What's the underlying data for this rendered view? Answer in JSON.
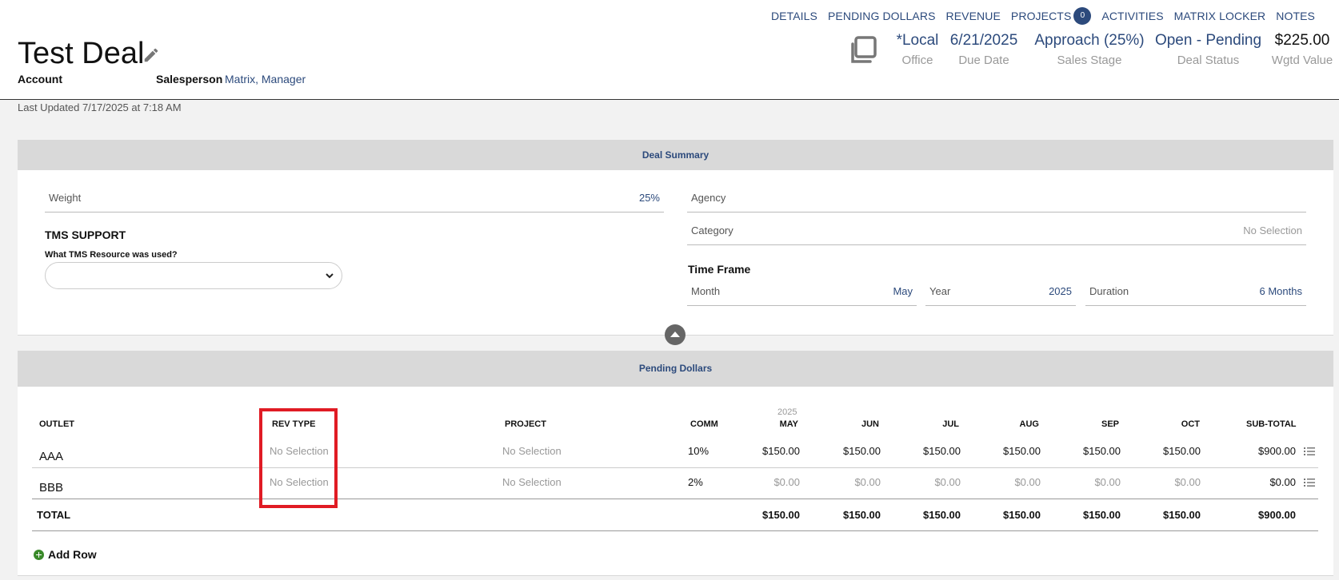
{
  "nav": [
    {
      "label": "DETAILS"
    },
    {
      "label": "PENDING DOLLARS"
    },
    {
      "label": "REVENUE"
    },
    {
      "label": "PROJECTS",
      "badge": "0"
    },
    {
      "label": "ACTIVITIES"
    },
    {
      "label": "MATRIX LOCKER"
    },
    {
      "label": "NOTES"
    }
  ],
  "deal": {
    "title": "Test Deal",
    "account_label": "Account",
    "salesperson_label": "Salesperson",
    "salesperson": "Matrix, Manager",
    "office": "*Local",
    "office_label": "Office",
    "due_date": "6/21/2025",
    "due_date_label": "Due Date",
    "sales_stage": "Approach (25%)",
    "sales_stage_label": "Sales Stage",
    "deal_status": "Open - Pending",
    "deal_status_label": "Deal Status",
    "wgtd_value": "$225.00",
    "wgtd_value_label": "Wgtd Value",
    "last_updated": "Last Updated 7/17/2025 at 7:18 AM"
  },
  "summary": {
    "heading": "Deal Summary",
    "weight_label": "Weight",
    "weight": "25%",
    "tms_heading": "TMS SUPPORT",
    "tms_question": "What TMS Resource was used?",
    "tms_value": "",
    "agency_label": "Agency",
    "agency": "",
    "category_label": "Category",
    "category": "No Selection",
    "timeframe_heading": "Time Frame",
    "month_label": "Month",
    "month": "May",
    "year_label": "Year",
    "year": "2025",
    "duration_label": "Duration",
    "duration": "6 Months"
  },
  "pending": {
    "heading": "Pending Dollars",
    "year_header": "2025",
    "columns": [
      "OUTLET",
      "REV TYPE",
      "PROJECT",
      "COMM",
      "MAY",
      "JUN",
      "JUL",
      "AUG",
      "SEP",
      "OCT",
      "SUB-TOTAL"
    ],
    "rows": [
      {
        "outlet": "AAA",
        "rev_type": "No Selection",
        "project": "No Selection",
        "comm": "10%",
        "months": [
          "$150.00",
          "$150.00",
          "$150.00",
          "$150.00",
          "$150.00",
          "$150.00"
        ],
        "subtotal": "$900.00"
      },
      {
        "outlet": "BBB",
        "rev_type": "No Selection",
        "project": "No Selection",
        "comm": "2%",
        "months": [
          "$0.00",
          "$0.00",
          "$0.00",
          "$0.00",
          "$0.00",
          "$0.00"
        ],
        "subtotal": "$0.00"
      }
    ],
    "total_label": "TOTAL",
    "totals": [
      "$150.00",
      "$150.00",
      "$150.00",
      "$150.00",
      "$150.00",
      "$150.00"
    ],
    "total_subtotal": "$900.00",
    "add_row_label": "Add Row"
  }
}
